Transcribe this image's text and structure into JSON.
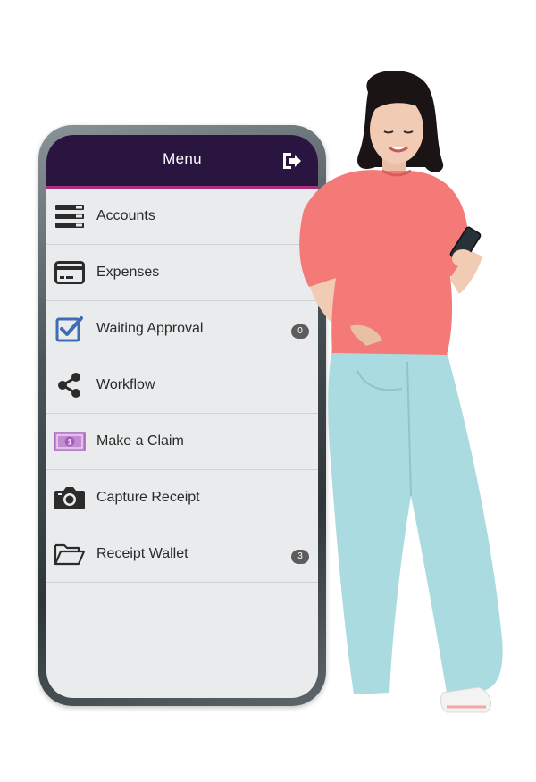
{
  "header": {
    "title": "Menu",
    "logout_icon": "logout-icon"
  },
  "menu": {
    "items": [
      {
        "label": "Accounts",
        "icon": "accounts-list-icon"
      },
      {
        "label": "Expenses",
        "icon": "credit-card-icon"
      },
      {
        "label": "Waiting Approval",
        "icon": "checkbox-checked-icon",
        "badge": "0"
      },
      {
        "label": "Workflow",
        "icon": "share-nodes-icon"
      },
      {
        "label": "Make a Claim",
        "icon": "banknote-icon"
      },
      {
        "label": "Capture Receipt",
        "icon": "camera-icon"
      },
      {
        "label": "Receipt Wallet",
        "icon": "folder-open-icon",
        "badge": "3"
      }
    ]
  },
  "colors": {
    "header_bg": "#2a1540",
    "header_accent": "#a8317a",
    "screen_bg": "#e9ebec",
    "checkbox_blue": "#3d6db5",
    "banknote_purple": "#b779c9",
    "sweater": "#f47a78",
    "jeans": "#a9dbe0"
  }
}
